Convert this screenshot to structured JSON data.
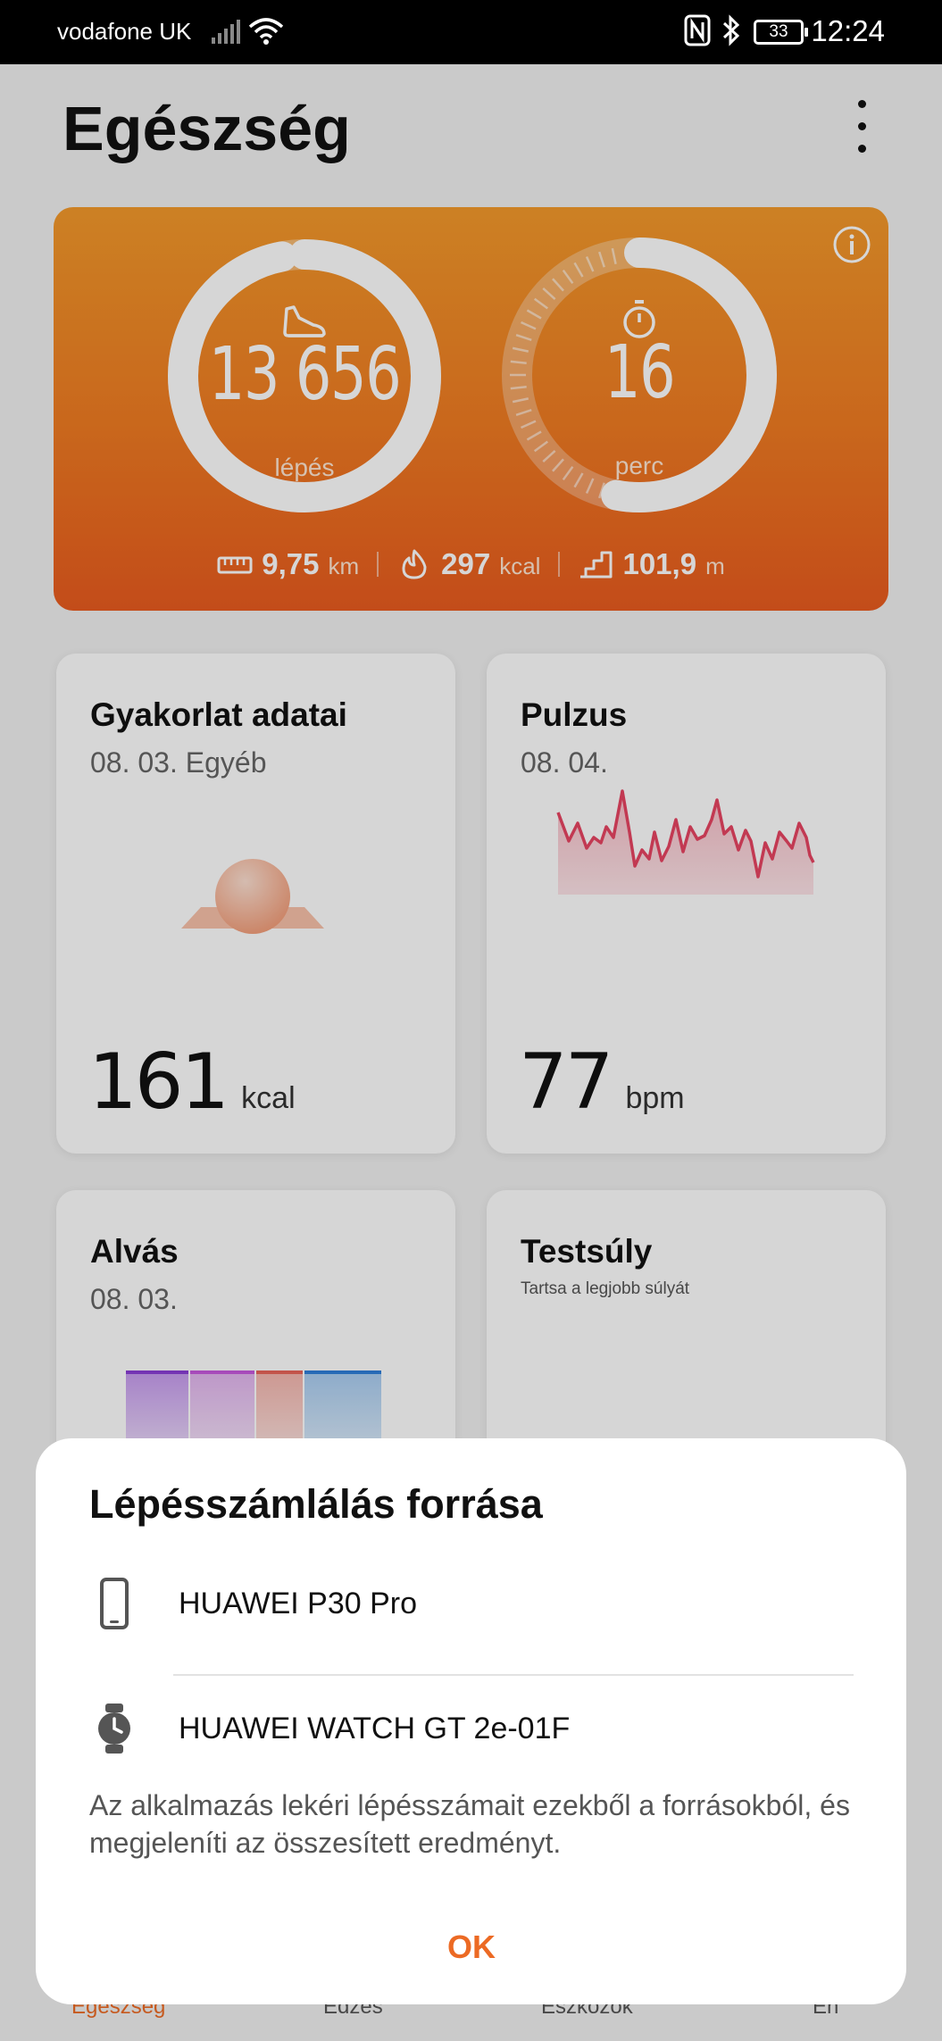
{
  "status_bar": {
    "carrier": "vodafone UK",
    "battery": "33",
    "time": "12:24"
  },
  "header": {
    "title": "Egészség"
  },
  "activity": {
    "steps": "13 656",
    "steps_unit": "lépés",
    "steps_progress": 0.97,
    "minutes": "16",
    "minutes_unit": "perc",
    "minutes_progress": 0.53,
    "distance": "9,75",
    "distance_unit": "km",
    "calories": "297",
    "calories_unit": "kcal",
    "climb": "101,9",
    "climb_unit": "m",
    "colors": {
      "top": "#f39a2b",
      "bottom": "#e95b1f"
    }
  },
  "cards": {
    "exercise": {
      "title": "Gyakorlat adatai",
      "subtitle": "08. 03. Egyéb",
      "value": "161",
      "unit": "kcal"
    },
    "pulse": {
      "title": "Pulzus",
      "subtitle": "08. 04.",
      "value": "77",
      "unit": "bpm"
    },
    "sleep": {
      "title": "Alvás",
      "subtitle": "08. 03."
    },
    "weight": {
      "title": "Testsúly",
      "subtitle": "Tartsa a legjobb súlyát"
    }
  },
  "bottom_nav": {
    "items": [
      "Egészség",
      "Edzés",
      "Eszközök",
      "Én"
    ]
  },
  "dialog": {
    "title": "Lépésszámlálás forrása",
    "sources": [
      "HUAWEI P30 Pro",
      "HUAWEI WATCH GT 2e-01F"
    ],
    "description": "Az alkalmazás lekéri lépésszámait ezekből a forrásokból, és megjeleníti az összesített eredményt.",
    "ok_label": "OK",
    "accent_color": "#ec6a24"
  }
}
